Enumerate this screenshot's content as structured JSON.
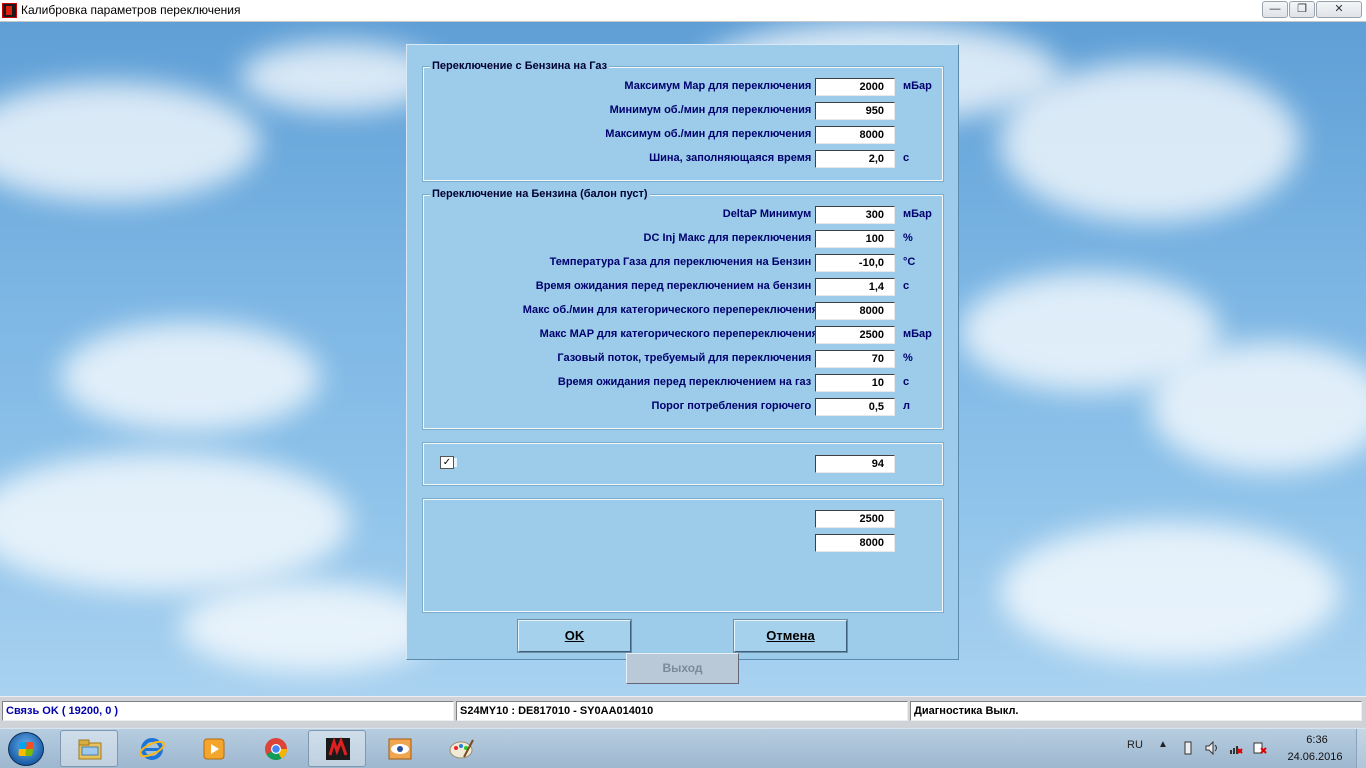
{
  "window": {
    "title": "Калибровка параметров переключения",
    "min_glyph": "—",
    "max_glyph": "❐",
    "close_glyph": "✕"
  },
  "group_petrol_to_gas": {
    "title": "Переключение с Бензина на Газ",
    "rows": [
      {
        "label": "Максимум Map для переключения :",
        "value": "2000",
        "unit": "мБар"
      },
      {
        "label": "Минимум об./мин для переключения :",
        "value": "950",
        "unit": ""
      },
      {
        "label": "Максимум об./мин для переключения :",
        "value": "8000",
        "unit": ""
      },
      {
        "label": "Шина, заполняющаяся время :",
        "value": "2,0",
        "unit": "с"
      }
    ]
  },
  "group_to_petrol": {
    "title": "Переключение на Бензина (балон пуст)",
    "rows": [
      {
        "label": "DeltaP Минимум :",
        "value": "300",
        "unit": "мБар"
      },
      {
        "label": "DC Inj Макс для переключения :",
        "value": "100",
        "unit": "%"
      },
      {
        "label": "Температура Газа для переключения на Бензин :",
        "value": "-10,0",
        "unit": "°C"
      },
      {
        "label": "Время ожидания перед переключением на бензин :",
        "value": "1,4",
        "unit": "с"
      },
      {
        "label": "Макс об./мин для категорического перепереключения",
        "value": "8000",
        "unit": ""
      },
      {
        "label": "Макс MAP для категорического перепереключения",
        "value": "2500",
        "unit": "мБар"
      },
      {
        "label": "Газовый поток, требуемый для переключения :",
        "value": "70",
        "unit": "%"
      },
      {
        "label": "Время ожидания перед переключением на газ :",
        "value": "10",
        "unit": "с"
      },
      {
        "label": "Порог потребления горючего :",
        "value": "0,5",
        "unit": "л"
      }
    ]
  },
  "group_checkbox": {
    "checked_glyph": "✓",
    "value": "94"
  },
  "group_extra": {
    "value1": "2500",
    "value2": "8000"
  },
  "buttons": {
    "ok": "OK",
    "cancel": "Отмена",
    "exit": "Выход"
  },
  "statusbar": {
    "connection": "Связь OK ( 19200,  0 )",
    "ecu": "S24MY10 : DE817010 - SY0AA014010",
    "diagnostics": "Диагностика Выкл."
  },
  "taskbar": {
    "items": [
      "explorer-icon",
      "internet-explorer-icon",
      "media-player-icon",
      "chrome-icon",
      "calibration-app-icon",
      "eye-app-icon",
      "paint-icon"
    ],
    "lang": "RU",
    "tray_arrow": "▲",
    "time": "6:36",
    "date": "24.06.2016"
  },
  "colors": {
    "dialog_bg": "#9ccce9",
    "label_text": "#00006e",
    "status_blue": "#0000aa"
  }
}
